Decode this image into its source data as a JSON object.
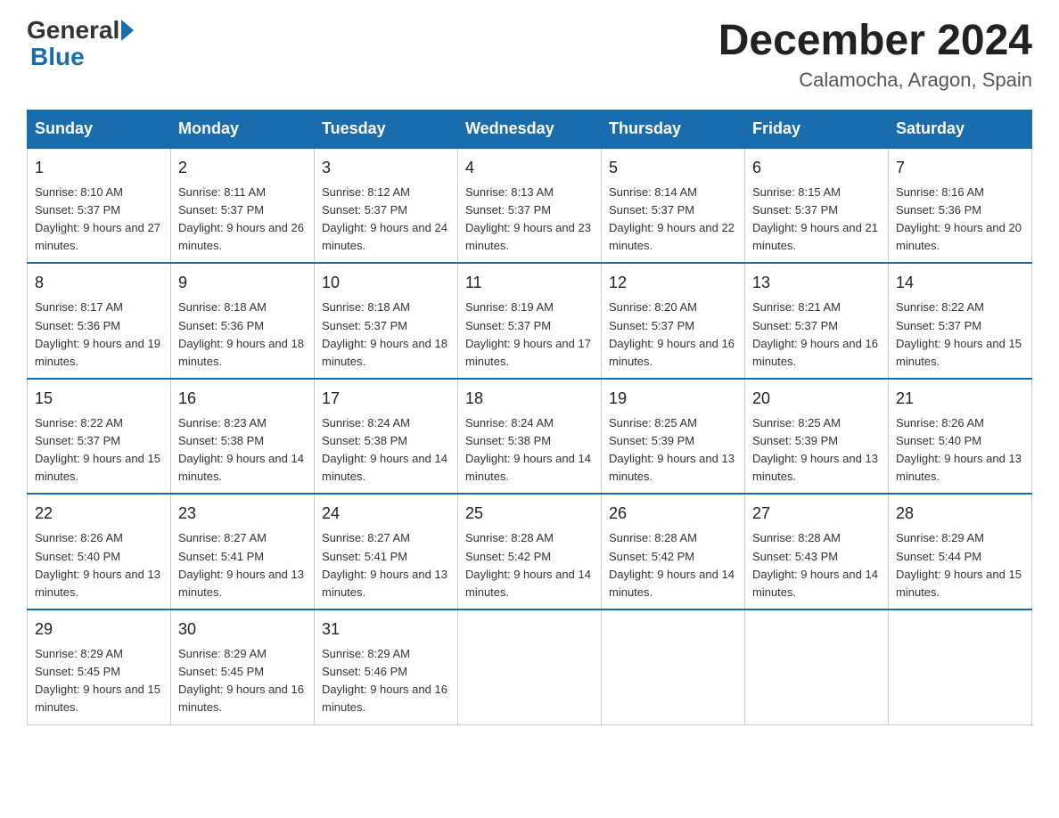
{
  "header": {
    "logo_general": "General",
    "logo_blue": "Blue",
    "title": "December 2024",
    "subtitle": "Calamocha, Aragon, Spain"
  },
  "weekdays": [
    "Sunday",
    "Monday",
    "Tuesday",
    "Wednesday",
    "Thursday",
    "Friday",
    "Saturday"
  ],
  "weeks": [
    [
      {
        "day": "1",
        "sunrise": "8:10 AM",
        "sunset": "5:37 PM",
        "daylight": "9 hours and 27 minutes."
      },
      {
        "day": "2",
        "sunrise": "8:11 AM",
        "sunset": "5:37 PM",
        "daylight": "9 hours and 26 minutes."
      },
      {
        "day": "3",
        "sunrise": "8:12 AM",
        "sunset": "5:37 PM",
        "daylight": "9 hours and 24 minutes."
      },
      {
        "day": "4",
        "sunrise": "8:13 AM",
        "sunset": "5:37 PM",
        "daylight": "9 hours and 23 minutes."
      },
      {
        "day": "5",
        "sunrise": "8:14 AM",
        "sunset": "5:37 PM",
        "daylight": "9 hours and 22 minutes."
      },
      {
        "day": "6",
        "sunrise": "8:15 AM",
        "sunset": "5:37 PM",
        "daylight": "9 hours and 21 minutes."
      },
      {
        "day": "7",
        "sunrise": "8:16 AM",
        "sunset": "5:36 PM",
        "daylight": "9 hours and 20 minutes."
      }
    ],
    [
      {
        "day": "8",
        "sunrise": "8:17 AM",
        "sunset": "5:36 PM",
        "daylight": "9 hours and 19 minutes."
      },
      {
        "day": "9",
        "sunrise": "8:18 AM",
        "sunset": "5:36 PM",
        "daylight": "9 hours and 18 minutes."
      },
      {
        "day": "10",
        "sunrise": "8:18 AM",
        "sunset": "5:37 PM",
        "daylight": "9 hours and 18 minutes."
      },
      {
        "day": "11",
        "sunrise": "8:19 AM",
        "sunset": "5:37 PM",
        "daylight": "9 hours and 17 minutes."
      },
      {
        "day": "12",
        "sunrise": "8:20 AM",
        "sunset": "5:37 PM",
        "daylight": "9 hours and 16 minutes."
      },
      {
        "day": "13",
        "sunrise": "8:21 AM",
        "sunset": "5:37 PM",
        "daylight": "9 hours and 16 minutes."
      },
      {
        "day": "14",
        "sunrise": "8:22 AM",
        "sunset": "5:37 PM",
        "daylight": "9 hours and 15 minutes."
      }
    ],
    [
      {
        "day": "15",
        "sunrise": "8:22 AM",
        "sunset": "5:37 PM",
        "daylight": "9 hours and 15 minutes."
      },
      {
        "day": "16",
        "sunrise": "8:23 AM",
        "sunset": "5:38 PM",
        "daylight": "9 hours and 14 minutes."
      },
      {
        "day": "17",
        "sunrise": "8:24 AM",
        "sunset": "5:38 PM",
        "daylight": "9 hours and 14 minutes."
      },
      {
        "day": "18",
        "sunrise": "8:24 AM",
        "sunset": "5:38 PM",
        "daylight": "9 hours and 14 minutes."
      },
      {
        "day": "19",
        "sunrise": "8:25 AM",
        "sunset": "5:39 PM",
        "daylight": "9 hours and 13 minutes."
      },
      {
        "day": "20",
        "sunrise": "8:25 AM",
        "sunset": "5:39 PM",
        "daylight": "9 hours and 13 minutes."
      },
      {
        "day": "21",
        "sunrise": "8:26 AM",
        "sunset": "5:40 PM",
        "daylight": "9 hours and 13 minutes."
      }
    ],
    [
      {
        "day": "22",
        "sunrise": "8:26 AM",
        "sunset": "5:40 PM",
        "daylight": "9 hours and 13 minutes."
      },
      {
        "day": "23",
        "sunrise": "8:27 AM",
        "sunset": "5:41 PM",
        "daylight": "9 hours and 13 minutes."
      },
      {
        "day": "24",
        "sunrise": "8:27 AM",
        "sunset": "5:41 PM",
        "daylight": "9 hours and 13 minutes."
      },
      {
        "day": "25",
        "sunrise": "8:28 AM",
        "sunset": "5:42 PM",
        "daylight": "9 hours and 14 minutes."
      },
      {
        "day": "26",
        "sunrise": "8:28 AM",
        "sunset": "5:42 PM",
        "daylight": "9 hours and 14 minutes."
      },
      {
        "day": "27",
        "sunrise": "8:28 AM",
        "sunset": "5:43 PM",
        "daylight": "9 hours and 14 minutes."
      },
      {
        "day": "28",
        "sunrise": "8:29 AM",
        "sunset": "5:44 PM",
        "daylight": "9 hours and 15 minutes."
      }
    ],
    [
      {
        "day": "29",
        "sunrise": "8:29 AM",
        "sunset": "5:45 PM",
        "daylight": "9 hours and 15 minutes."
      },
      {
        "day": "30",
        "sunrise": "8:29 AM",
        "sunset": "5:45 PM",
        "daylight": "9 hours and 16 minutes."
      },
      {
        "day": "31",
        "sunrise": "8:29 AM",
        "sunset": "5:46 PM",
        "daylight": "9 hours and 16 minutes."
      },
      null,
      null,
      null,
      null
    ]
  ]
}
